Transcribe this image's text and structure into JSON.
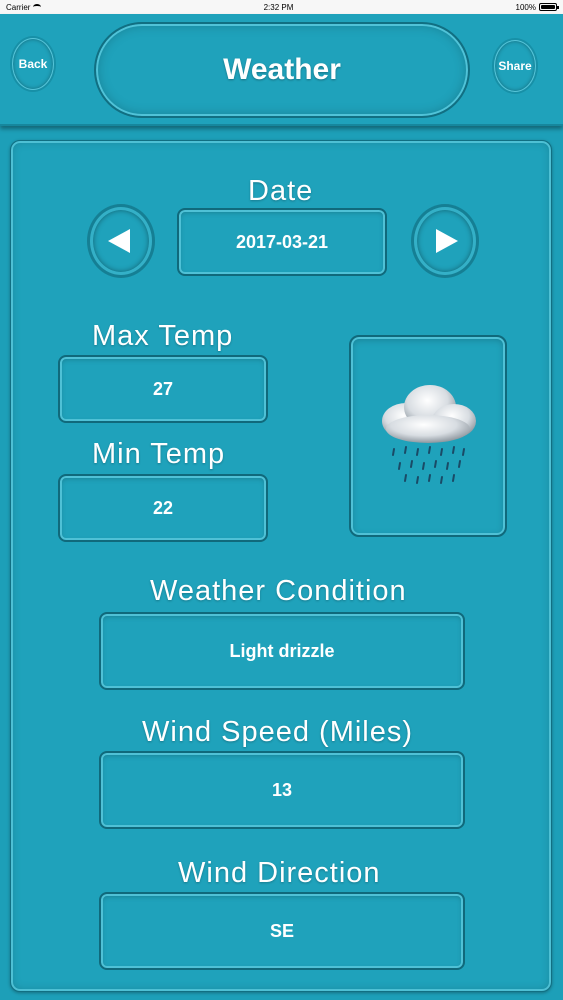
{
  "status": {
    "carrier": "Carrier",
    "time": "2:32 PM",
    "battery": "100%"
  },
  "nav": {
    "back_label": "Back",
    "title": "Weather",
    "share_label": "Share"
  },
  "date": {
    "label": "Date",
    "value": "2017-03-21"
  },
  "max_temp": {
    "label": "Max Temp",
    "value": "27"
  },
  "min_temp": {
    "label": "Min Temp",
    "value": "22"
  },
  "weather_icon": "rain-cloud-icon",
  "condition": {
    "label": "Weather Condition",
    "value": "Light drizzle"
  },
  "wind_speed": {
    "label": "Wind Speed (Miles)",
    "value": "13"
  },
  "wind_direction": {
    "label": "Wind Direction",
    "value": "SE"
  },
  "colors": {
    "background": "#1d9fb8",
    "highlight": "#4fc1d6",
    "shadow": "#10697b"
  }
}
